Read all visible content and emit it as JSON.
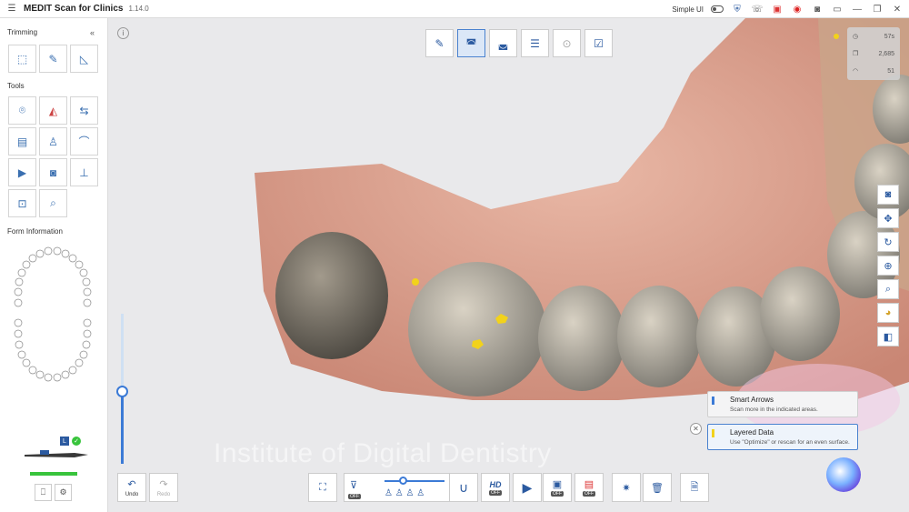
{
  "app": {
    "brand": "MEDIT Scan for Clinics",
    "version": "1.14.0",
    "simple_ui_label": "Simple UI"
  },
  "sidebar": {
    "trimming_title": "Trimming",
    "tools_title": "Tools",
    "form_info_title": "Form Information",
    "scanner_badge": "L",
    "progress_color": "#38c43c"
  },
  "stats": {
    "time": "57s",
    "count": "2,685",
    "speed": "51"
  },
  "cards": {
    "smart_arrows": {
      "title": "Smart Arrows",
      "subtitle": "Scan more in the indicated areas."
    },
    "layered_data": {
      "title": "Layered Data",
      "subtitle": "Use \"Optimize\" or rescan for an even surface."
    }
  },
  "bottom": {
    "undo": "Undo",
    "redo": "Redo",
    "hd": "HD",
    "off": "OFF"
  },
  "watermark": "Institute of Digital Dentistry",
  "colors": {
    "accent": "#3b7ad6",
    "highlight_yellow": "#f2d21b"
  }
}
